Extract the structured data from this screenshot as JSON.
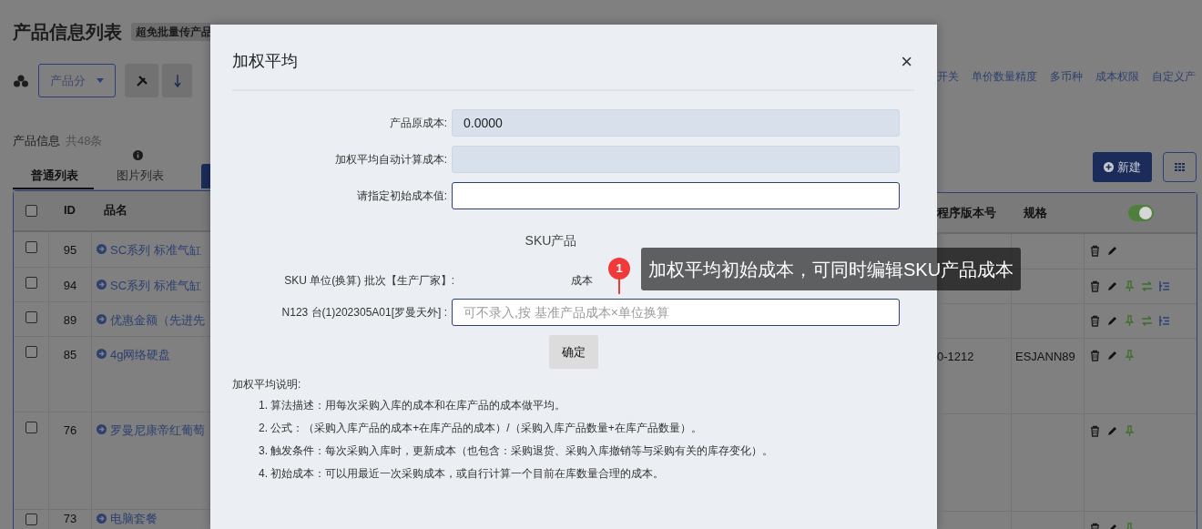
{
  "page": {
    "title": "产品信息列表",
    "badge": "超免批量传产品",
    "category_select": {
      "placeholder": "产品分"
    },
    "top_links": [
      "开关",
      "单价数量精度",
      "多币种",
      "成本权限",
      "自定义产"
    ],
    "count_label": "产品信息",
    "count": "共48条",
    "tabs": [
      {
        "label": "普通列表",
        "selected": true
      },
      {
        "label": "图片列表",
        "selected": false
      }
    ],
    "new_button": "新建"
  },
  "table": {
    "header_checked": false,
    "columns_left": [
      "ID",
      "品名"
    ],
    "columns_right": [
      "程序版本号",
      "规格"
    ],
    "toggle": {
      "on": true
    },
    "rows": [
      {
        "checked": false,
        "id": "95",
        "name": "SC系列 标准气缸",
        "actions": [
          {
            "kind": "delete"
          },
          {
            "kind": "edit"
          }
        ]
      },
      {
        "checked": false,
        "id": "94",
        "name": "SC系列 标准气缸",
        "actions": [
          {
            "kind": "delete"
          },
          {
            "kind": "edit"
          },
          {
            "kind": "pin"
          },
          {
            "kind": "transfer"
          },
          {
            "kind": "tree"
          }
        ]
      },
      {
        "checked": false,
        "id": "89",
        "name": "优惠金额（先进先",
        "actions": [
          {
            "kind": "delete"
          },
          {
            "kind": "edit"
          },
          {
            "kind": "pin"
          },
          {
            "kind": "transfer"
          },
          {
            "kind": "tree"
          }
        ]
      },
      {
        "checked": false,
        "id": "85",
        "name": "4g网络硬盘",
        "version": "0-1212",
        "spec": "ESJANN89",
        "actions": [
          {
            "kind": "delete"
          },
          {
            "kind": "edit"
          },
          {
            "kind": "pin"
          }
        ]
      },
      {
        "checked": false,
        "id": "76",
        "name": "罗曼尼康帝红葡萄",
        "actions": [
          {
            "kind": "delete"
          },
          {
            "kind": "edit"
          },
          {
            "kind": "pin"
          }
        ]
      },
      {
        "checked": false,
        "id": "73",
        "name": "电脑套餐",
        "actions": [
          {
            "kind": "delete"
          },
          {
            "kind": "edit"
          },
          {
            "kind": "pin"
          }
        ]
      }
    ]
  },
  "dialog": {
    "title": "加权平均",
    "close": "×",
    "fields": [
      {
        "label": "产品原成本:",
        "value": "0.0000",
        "disabled": true
      },
      {
        "label": "加权平均自动计算成本:",
        "disabled": true
      },
      {
        "label": "请指定初始成本值:",
        "disabled": false
      }
    ],
    "sku_heading": "SKU产品",
    "sku_columns": [
      "SKU 单位(换算) 批次【生产厂家】:",
      "成本"
    ],
    "sku_rows": [
      {
        "label": "N123 台(1)202305A01[罗曼天外] :",
        "placeholder": "可不录入,按 基准产品成本×单位换算"
      }
    ],
    "confirm": "确定",
    "notes_title": "加权平均说明:",
    "notes": [
      "1. 算法描述：用每次采购入库的成本和在库产品的成本做平均。",
      "2. 公式：（采购入库产品的成本+在库产品的成本）/（采购入库产品数量+在库产品数量）。",
      "3. 触发条件：每次采购入库时，更新成本（也包含：采购退货、采购入库撤销等与采购有关的库存变化）。",
      "4. 初始成本：可以用最近一次采购成本，或自行计算一个目前在库数量合理的成本。"
    ]
  },
  "tooltip": {
    "badge": "1",
    "text": "加权平均初始成本，可同时编辑SKU产品成本"
  }
}
